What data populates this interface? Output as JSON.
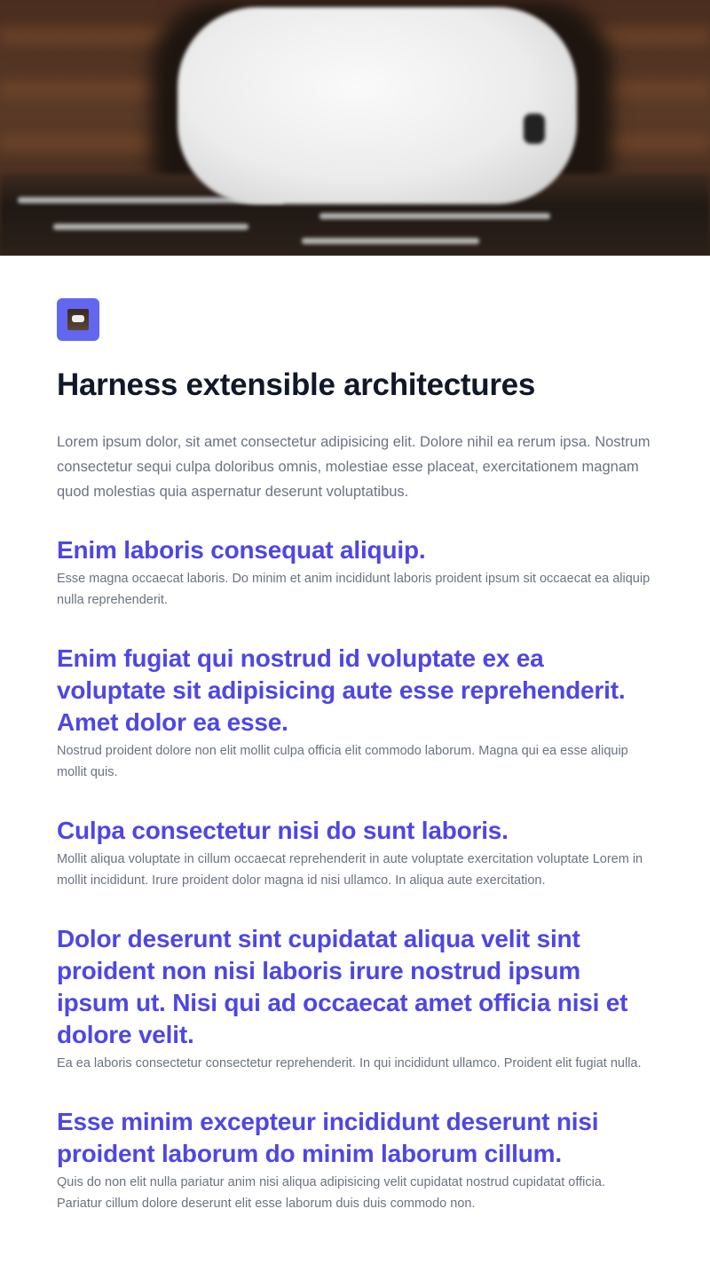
{
  "hero": {
    "image_icon": "airpods-case-photo"
  },
  "logo": {
    "icon": "product-thumbnail-icon",
    "bg_color": "#6366f1"
  },
  "page_title": "Harness extensible architectures",
  "intro": "Lorem ipsum dolor, sit amet consectetur adipisicing elit. Dolore nihil ea rerum ipsa. Nostrum consectetur sequi culpa doloribus omnis, molestiae esse placeat, exercitationem magnam quod molestias quia aspernatur deserunt voluptatibus.",
  "features": [
    {
      "title": "Enim laboris consequat aliquip.",
      "body": "Esse magna occaecat laboris. Do minim et anim incididunt laboris proident ipsum sit occaecat ea aliquip nulla reprehenderit."
    },
    {
      "title": "Enim fugiat qui nostrud id voluptate ex ea voluptate sit adipisicing aute esse reprehenderit. Amet dolor ea esse.",
      "body": "Nostrud proident dolore non elit mollit culpa officia elit commodo laborum. Magna qui ea esse aliquip mollit quis."
    },
    {
      "title": "Culpa consectetur nisi do sunt laboris.",
      "body": "Mollit aliqua voluptate in cillum occaecat reprehenderit in aute voluptate exercitation voluptate Lorem in mollit incididunt. Irure proident dolor magna id nisi ullamco. In aliqua aute exercitation."
    },
    {
      "title": "Dolor deserunt sint cupidatat aliqua velit sint proident non nisi laboris irure nostrud ipsum ipsum ut. Nisi qui ad occaecat amet officia nisi et dolore velit.",
      "body": "Ea ea laboris consectetur consectetur reprehenderit. In qui incididunt ullamco. Proident elit fugiat nulla."
    },
    {
      "title": "Esse minim excepteur incididunt deserunt nisi proident laborum do minim laborum cillum.",
      "body": "Quis do non elit nulla pariatur anim nisi aliqua adipisicing velit cupidatat nostrud cupidatat officia. Pariatur cillum dolore deserunt elit esse laborum duis duis commodo non."
    }
  ],
  "colors": {
    "accent": "#4f46e5",
    "heading": "#111827",
    "body_text": "#6b7280"
  }
}
